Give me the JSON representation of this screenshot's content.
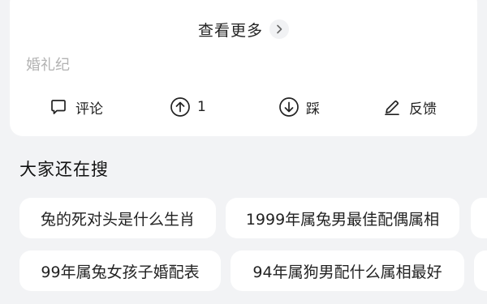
{
  "card": {
    "see_more_label": "查看更多",
    "source": "婚礼纪",
    "actions": [
      {
        "icon": "comment-icon",
        "label": "评论"
      },
      {
        "icon": "upvote-icon",
        "label": "1"
      },
      {
        "icon": "downvote-icon",
        "label": "踩"
      },
      {
        "icon": "feedback-icon",
        "label": "反馈"
      }
    ]
  },
  "related": {
    "title": "大家还在搜",
    "chips": [
      "兔的死对头是什么生肖",
      "1999年属兔男最佳配偶属相",
      "99年属兔女孩子婚配表",
      "94年属狗男配什么属相最好"
    ]
  }
}
